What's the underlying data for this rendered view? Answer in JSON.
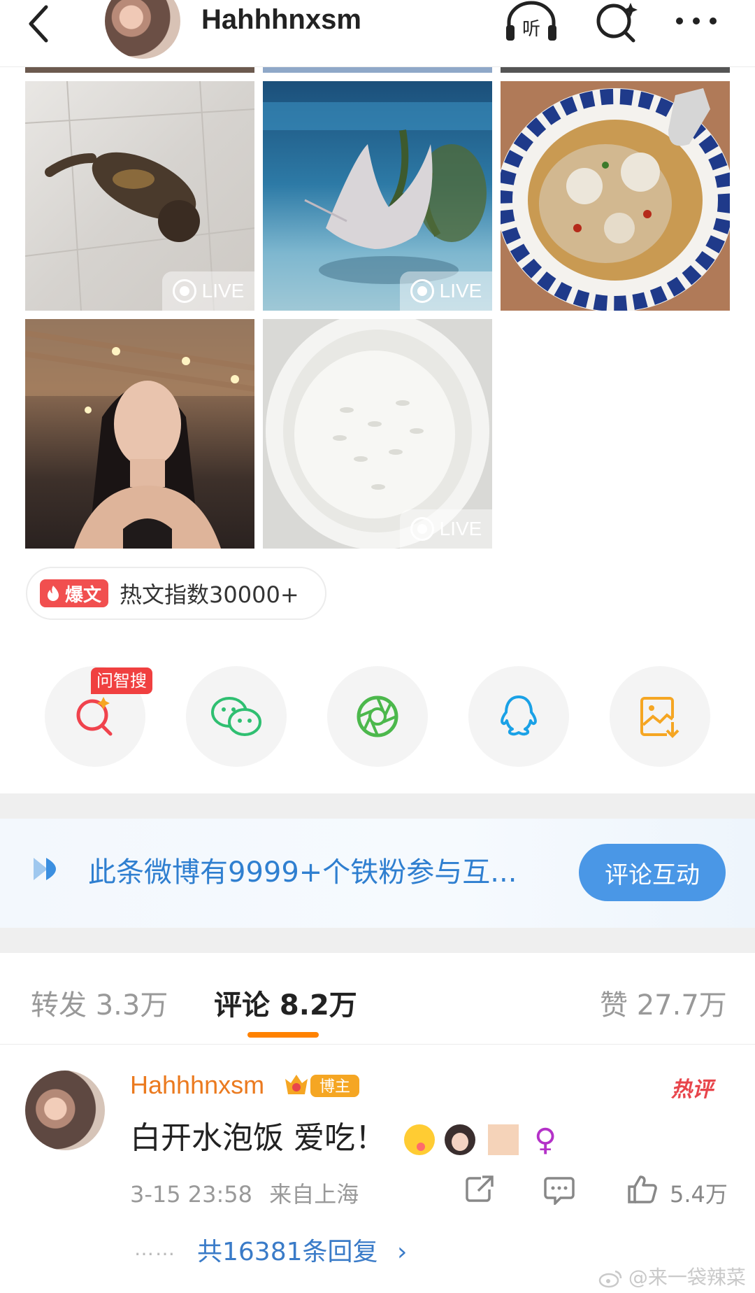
{
  "header": {
    "username": "Hahhhnxsm",
    "listen_label": "听"
  },
  "photos": {
    "live_label": "LIVE",
    "items": [
      {
        "name": "cat-photo",
        "live": true
      },
      {
        "name": "stingray-photo",
        "live": true
      },
      {
        "name": "noodle-bowl-photo",
        "live": false
      },
      {
        "name": "selfie-photo",
        "live": false
      },
      {
        "name": "rice-bowl-photo",
        "live": true
      }
    ]
  },
  "hot": {
    "tag": "爆文",
    "text": "热文指数30000+"
  },
  "share": {
    "ai_tag": "问智搜",
    "items": [
      "ai-search",
      "wechat",
      "moments",
      "qq",
      "save-image"
    ]
  },
  "fans_banner": {
    "text": "此条微博有9999+个铁粉参与互...",
    "button": "评论互动"
  },
  "stats": {
    "repost": "转发 3.3万",
    "comment": "评论 8.2万",
    "like": "赞 27.7万"
  },
  "comment": {
    "author": "Hahhhnxsm",
    "badge": "博主",
    "hot_label": "热评",
    "text": "白开水泡饭 爱吃！",
    "time": "3-15 23:58",
    "location": "来自上海",
    "likes": "5.4万",
    "replies_dots": "……",
    "replies": "共16381条回复",
    "replies_arrow": "›"
  },
  "watermark": "@来一袋辣菜",
  "colors": {
    "accent_orange": "#ff8200",
    "link_blue": "#3a7bc8",
    "hot_red": "#f14f4f",
    "author_orange": "#eb7a1f"
  }
}
